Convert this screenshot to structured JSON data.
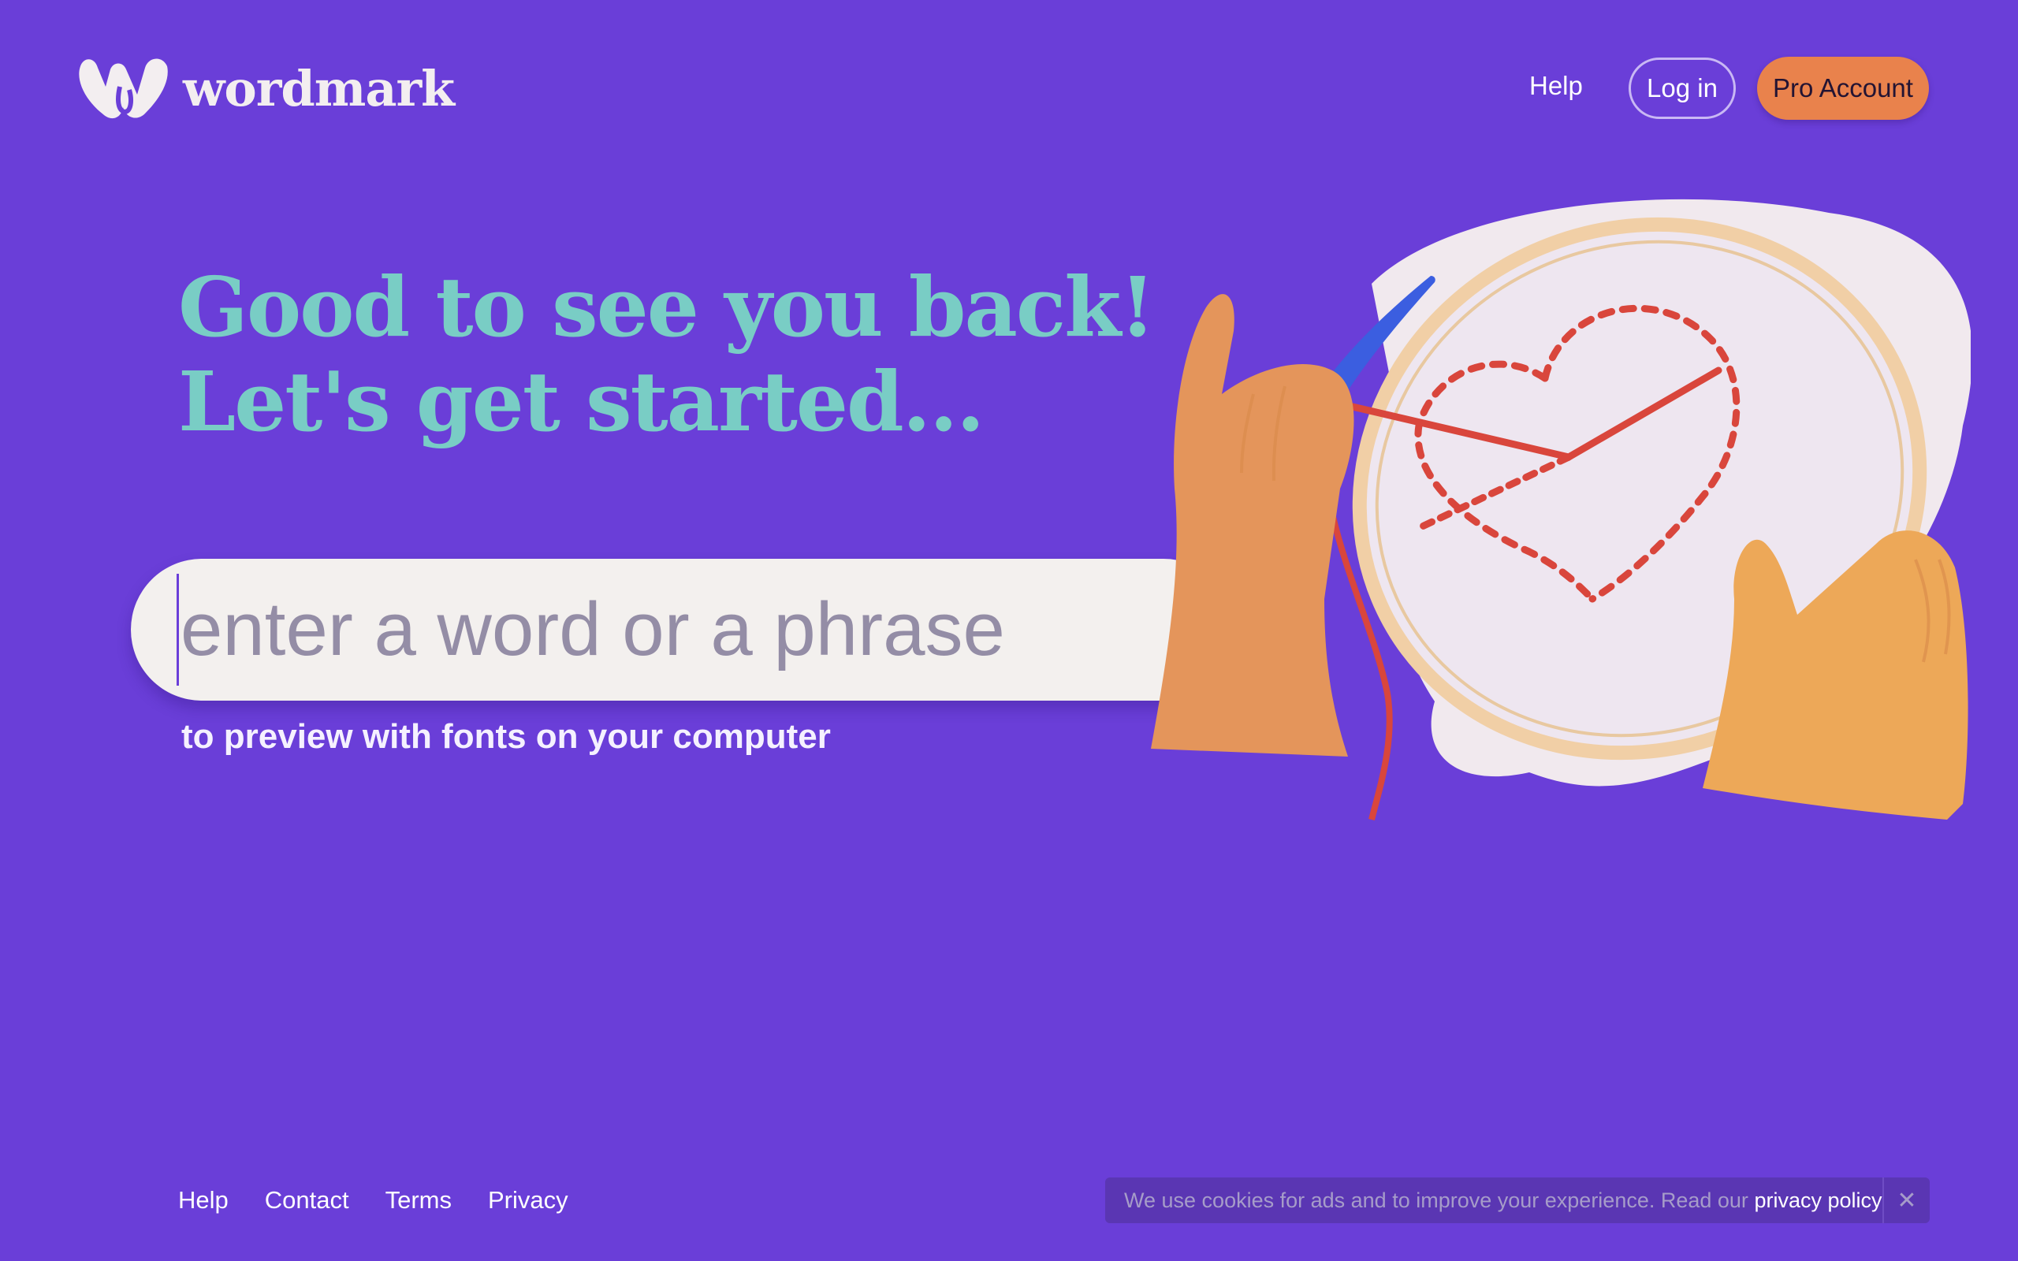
{
  "brand": {
    "name": "wordmark",
    "logo_icon": "heart-w-logo"
  },
  "nav": {
    "help": "Help",
    "login": "Log in",
    "pro": "Pro Account"
  },
  "hero": {
    "line1": "Good to see you back!",
    "line2": "Let's get started...",
    "illustration_icon": "embroidery-hoop-illustration"
  },
  "search": {
    "placeholder": "enter a word or a phrase",
    "value": "",
    "hint": "to preview with fonts on your computer"
  },
  "footer": {
    "links": [
      "Help",
      "Contact",
      "Terms",
      "Privacy"
    ]
  },
  "cookie": {
    "message": "We use cookies for ads and to improve your experience. Read our ",
    "link": "privacy policy",
    "close": "✕"
  },
  "colors": {
    "background": "#6a3ed8",
    "headline": "#79cdc5",
    "pro_button": "#e9824c",
    "search_bg": "#f3f0ee",
    "cookie_bg": "#5a36b3"
  }
}
